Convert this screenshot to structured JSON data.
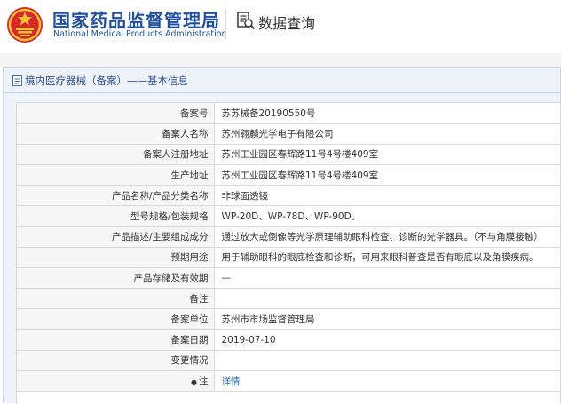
{
  "header": {
    "agency_cn": "国家药品监督管理局",
    "agency_en": "National Medical Products Administration",
    "query_label": "数据查询"
  },
  "panel": {
    "title": "境内医疗器械（备案）——基本信息"
  },
  "rows": [
    {
      "label": "备案号",
      "value": "苏苏械备20190550号"
    },
    {
      "label": "备案人名称",
      "value": "苏州翱麟光学电子有限公司"
    },
    {
      "label": "备案人注册地址",
      "value": "苏州工业园区春辉路11号4号楼409室"
    },
    {
      "label": "生产地址",
      "value": "苏州工业园区春辉路11号4号楼409室"
    },
    {
      "label": "产品名称/产品分类名称",
      "value": "非球面透镜"
    },
    {
      "label": "型号规格/包装规格",
      "value": "WP-20D、WP-78D、WP-90D。"
    },
    {
      "label": "产品描述/主要组成成分",
      "value": "通过放大或倒像等光学原理辅助眼科检查、诊断的光学器具。（不与角膜接触）"
    },
    {
      "label": "预期用途",
      "value": "用于辅助眼科的眼底检查和诊断，可用来眼科普查是否有眼底以及角膜疾病。"
    },
    {
      "label": "产品存储及有效期",
      "value": "—"
    },
    {
      "label": "备注",
      "value": ""
    },
    {
      "label": "备案单位",
      "value": "苏州市市场监督管理局"
    },
    {
      "label": "备案日期",
      "value": "2019-07-10"
    },
    {
      "label": "变更情况",
      "value": ""
    },
    {
      "label": "注",
      "value": "详情"
    }
  ],
  "colors": {
    "brand_blue": "#1f4f9e",
    "emblem_red": "#d8262b",
    "emblem_gold": "#f2c230",
    "link": "#2c6fbf"
  },
  "icons": {
    "emblem": "national-emblem",
    "query": "search-document-icon",
    "panel": "document-icon",
    "note": "star-marker-icon"
  }
}
